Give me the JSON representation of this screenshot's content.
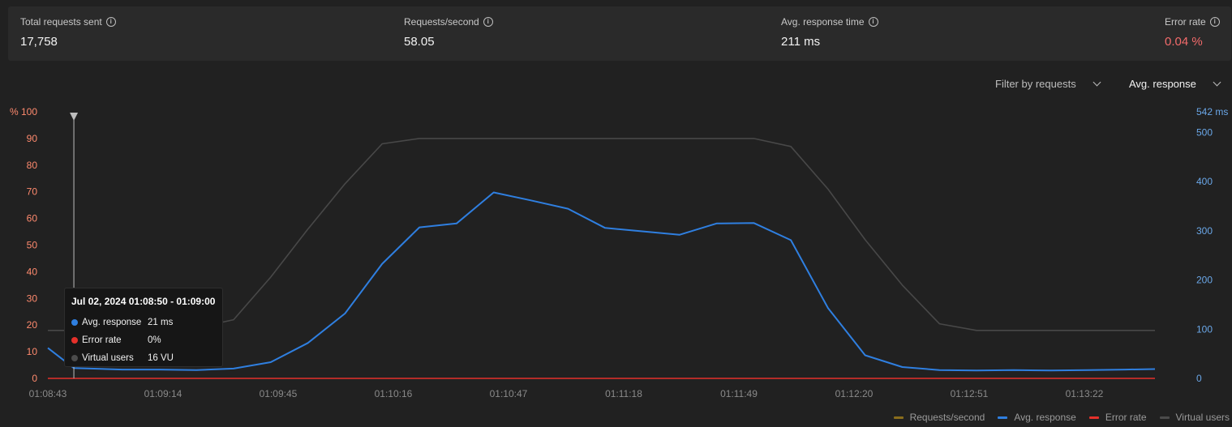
{
  "stats": [
    {
      "label": "Total requests sent",
      "value": "17,758"
    },
    {
      "label": "Requests/second",
      "value": "58.05"
    },
    {
      "label": "Avg. response time",
      "value": "211 ms"
    },
    {
      "label": "Error rate",
      "value": "0.04 %"
    }
  ],
  "filter_label": "Filter by requests",
  "metric_label": "Avg. response",
  "tooltip": {
    "title": "Jul 02, 2024 01:08:50 - 01:09:00",
    "rows": [
      {
        "label": "Avg. response",
        "value": "21 ms",
        "color": "#2f7fe0"
      },
      {
        "label": "Error rate",
        "value": "0%",
        "color": "#e5302a"
      },
      {
        "label": "Virtual users",
        "value": "16 VU",
        "color": "#4b4b4b"
      }
    ]
  },
  "legend": [
    {
      "label": "Requests/second",
      "color": "#8a6d1c"
    },
    {
      "label": "Avg. response",
      "color": "#2f7fe0"
    },
    {
      "label": "Error rate",
      "color": "#e5302a"
    },
    {
      "label": "Virtual users",
      "color": "#4b4b4b"
    }
  ],
  "colors": {
    "avg_response": "#2f7fe0",
    "error_rate": "#e5302a",
    "virtual_users": "#484848",
    "left_axis": "#ff8a6e",
    "right_axis": "#6aa7e8"
  },
  "chart_data": {
    "type": "line",
    "left_axis": {
      "unit": "%",
      "ylim": [
        0,
        100
      ],
      "ticks": [
        0,
        10,
        20,
        30,
        40,
        50,
        60,
        70,
        80,
        90,
        100
      ],
      "top_label": "% 100"
    },
    "right_axis": {
      "unit": "ms",
      "ylim": [
        0,
        542
      ],
      "ticks": [
        0,
        100,
        200,
        300,
        400,
        500
      ],
      "top_label": "542 ms"
    },
    "x_tick_labels": [
      "01:08:43",
      "01:09:14",
      "01:09:45",
      "01:10:16",
      "01:10:47",
      "01:11:18",
      "01:11:49",
      "01:12:20",
      "01:12:51",
      "01:13:22"
    ],
    "x_tick_seconds": [
      0,
      31,
      62,
      93,
      124,
      155,
      186,
      217,
      248,
      279
    ],
    "cursor_second": 7,
    "series": [
      {
        "name": "Virtual users",
        "axis": "left",
        "x": [
          0,
          10,
          20,
          30,
          40,
          50,
          60,
          70,
          80,
          90,
          100,
          110,
          120,
          130,
          140,
          150,
          160,
          170,
          180,
          190,
          200,
          210,
          220,
          230,
          240,
          250,
          260,
          270,
          280,
          290,
          298
        ],
        "y": [
          18,
          18,
          18,
          18,
          19,
          22,
          38,
          56,
          73,
          88,
          90,
          90,
          90,
          90,
          90,
          90,
          90,
          90,
          90,
          90,
          87,
          71,
          52,
          35,
          20.5,
          18,
          18,
          18,
          18,
          18,
          18
        ]
      },
      {
        "name": "Avg. response",
        "axis": "right",
        "x": [
          0,
          7,
          20,
          30,
          40,
          50,
          60,
          70,
          80,
          90,
          100,
          110,
          120,
          130,
          140,
          150,
          160,
          170,
          180,
          190,
          200,
          210,
          220,
          230,
          240,
          250,
          260,
          270,
          280,
          290,
          298
        ],
        "y": [
          62,
          21,
          18,
          18,
          17,
          20,
          33,
          72,
          132,
          233,
          307,
          315,
          378,
          362,
          345,
          306,
          299,
          292,
          315,
          316,
          281,
          143,
          47,
          23,
          17,
          16,
          17,
          16,
          17,
          18,
          19
        ]
      },
      {
        "name": "Error rate",
        "axis": "left",
        "x": [
          0,
          298
        ],
        "y": [
          0,
          0
        ]
      }
    ]
  }
}
